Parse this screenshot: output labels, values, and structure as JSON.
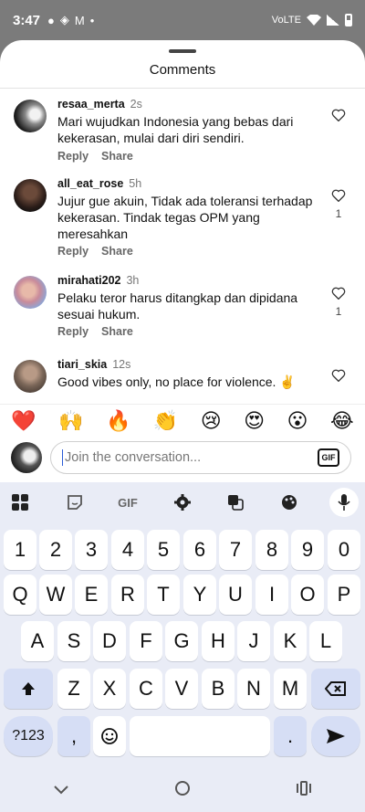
{
  "status": {
    "time": "3:47",
    "net": "VoLTE"
  },
  "sheet": {
    "title": "Comments"
  },
  "comments": [
    {
      "user": "resaa_merta",
      "time": "2s",
      "text": "Mari wujudkan Indonesia yang bebas dari kekerasan, mulai dari diri sendiri.",
      "reply": "Reply",
      "share": "Share",
      "likes": ""
    },
    {
      "user": "all_eat_rose",
      "time": "5h",
      "text": "Jujur gue akuin, Tidak ada toleransi terhadap kekerasan. Tindak tegas OPM yang meresahkan",
      "reply": "Reply",
      "share": "Share",
      "likes": "1"
    },
    {
      "user": "mirahati202",
      "time": "3h",
      "text": "Pelaku teror harus ditangkap dan dipidana sesuai hukum.",
      "reply": "Reply",
      "share": "Share",
      "likes": "1"
    },
    {
      "user": "tiari_skia",
      "time": "12s",
      "text": "Good vibes only, no place for violence. ✌️",
      "reply": "",
      "share": "",
      "likes": ""
    }
  ],
  "emojis": [
    "❤️",
    "🙌",
    "🔥",
    "👏",
    "😢",
    "😍",
    "😮",
    "😂"
  ],
  "composer": {
    "placeholder": "Join the conversation...",
    "gif": "GIF"
  },
  "keyboard": {
    "tools": {
      "gif": "GIF"
    },
    "row_numbers": [
      "1",
      "2",
      "3",
      "4",
      "5",
      "6",
      "7",
      "8",
      "9",
      "0"
    ],
    "row_q": [
      "Q",
      "W",
      "E",
      "R",
      "T",
      "Y",
      "U",
      "I",
      "O",
      "P"
    ],
    "row_a": [
      "A",
      "S",
      "D",
      "F",
      "G",
      "H",
      "J",
      "K",
      "L"
    ],
    "row_z": [
      "Z",
      "X",
      "C",
      "V",
      "B",
      "N",
      "M"
    ],
    "symbols": "?123",
    "comma": ",",
    "period": "."
  }
}
